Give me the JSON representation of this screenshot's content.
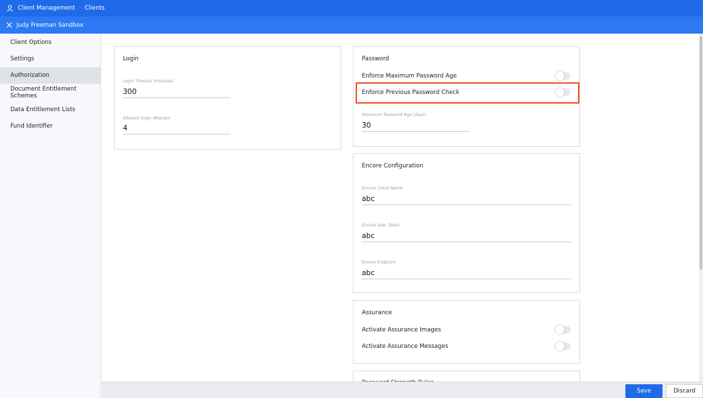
{
  "topbar": {
    "icon": "user-icon",
    "crumb_1": "Client Management",
    "crumb_2": "Clients"
  },
  "subbar": {
    "close_icon": "close-icon",
    "title": "Judy Freeman Sandbox"
  },
  "sidebar": {
    "items": [
      {
        "label": "Client Options",
        "active": false
      },
      {
        "label": "Settings",
        "active": false
      },
      {
        "label": "Authorization",
        "active": true
      },
      {
        "label": "Document Entitlement Schemes",
        "active": false
      },
      {
        "label": "Data Entitlement Lists",
        "active": false
      },
      {
        "label": "Fund Identifier",
        "active": false
      }
    ]
  },
  "login": {
    "title": "Login",
    "timeout_label": "Login Timeout (minutes)",
    "timeout_value": "300",
    "attempts_label": "Allowed Login Attemps",
    "attempts_value": "4"
  },
  "password": {
    "title": "Password",
    "enforce_max_age_label": "Enforce Maximum Password Age",
    "enforce_max_age_on": false,
    "enforce_previous_label": "Enforce Previous Password Check",
    "enforce_previous_on": false,
    "max_age_label": "Maximum Password Age (days)",
    "max_age_value": "30"
  },
  "encore": {
    "title": "Encore Configuration",
    "client_name_label": "Encore Client Name",
    "client_name_value": "abc",
    "user_token_label": "Encore User Token",
    "user_token_value": "abc",
    "endpoint_label": "Encore Endpoint",
    "endpoint_value": "abc"
  },
  "assurance": {
    "title": "Assurance",
    "images_label": "Activate Assurance Images",
    "images_on": false,
    "messages_label": "Activate Assurance Messages",
    "messages_on": false
  },
  "strength": {
    "title": "Password Strength Rules"
  },
  "footer": {
    "save_label": "Save",
    "discard_label": "Discard"
  },
  "colors": {
    "topbar": "#1f6ae8",
    "subbar": "#2d79f4",
    "highlight": "#f05028"
  }
}
